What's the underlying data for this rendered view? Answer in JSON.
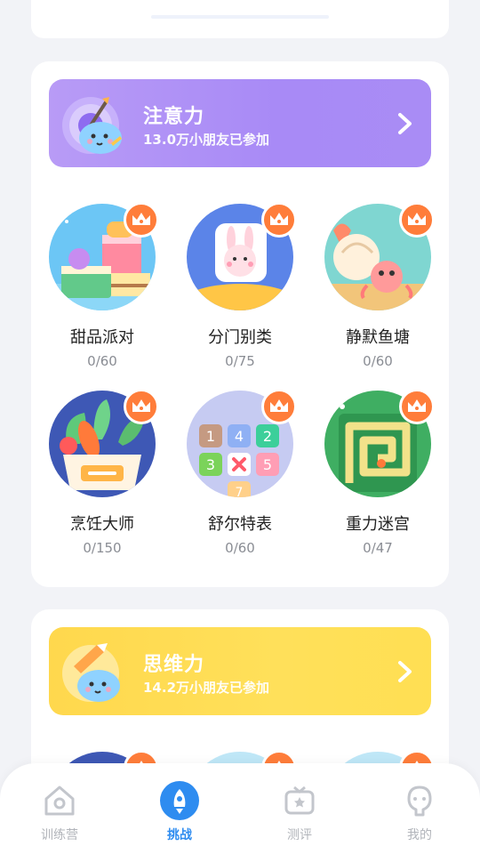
{
  "sections": [
    {
      "banner": {
        "title": "注意力",
        "subtitle": "13.0万小朋友已参加",
        "color": "#a98cf6"
      },
      "games": [
        {
          "name": "甜品派对",
          "progress": "0/60"
        },
        {
          "name": "分门别类",
          "progress": "0/75"
        },
        {
          "name": "静默鱼塘",
          "progress": "0/60"
        },
        {
          "name": "烹饪大师",
          "progress": "0/150"
        },
        {
          "name": "舒尔特表",
          "progress": "0/60"
        },
        {
          "name": "重力迷宫",
          "progress": "0/47"
        }
      ]
    },
    {
      "banner": {
        "title": "思维力",
        "subtitle": "14.2万小朋友已参加",
        "color": "#ffdb50"
      }
    }
  ],
  "schulte_numbers": [
    "1",
    "4",
    "2",
    "3",
    "5",
    "7"
  ],
  "tabs": [
    {
      "label": "训练营",
      "icon": "home-icon"
    },
    {
      "label": "挑战",
      "icon": "rocket-icon",
      "active": true
    },
    {
      "label": "测评",
      "icon": "tv-star-icon"
    },
    {
      "label": "我的",
      "icon": "profile-icon"
    }
  ],
  "colors": {
    "accent": "#2e8cf0",
    "crown": "#ff7d3a"
  }
}
